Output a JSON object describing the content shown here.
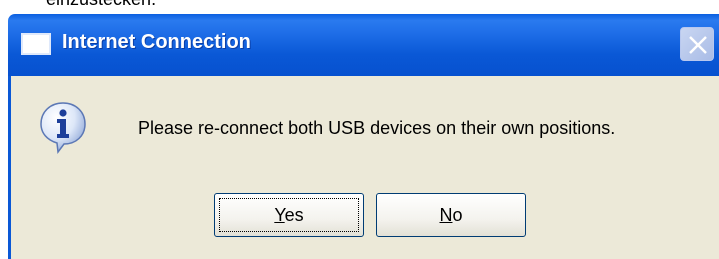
{
  "background_text": "einzustecken.",
  "dialog": {
    "title": "Internet Connection",
    "message": "Please re-connect both USB devices on their own positions.",
    "icon": "info-icon",
    "buttons": {
      "yes": {
        "accel": "Y",
        "rest": "es"
      },
      "no": {
        "accel": "N",
        "rest": "o"
      }
    }
  },
  "colors": {
    "titlebar": "#0a58d6",
    "client": "#ece9d8",
    "button_border": "#003c74"
  }
}
